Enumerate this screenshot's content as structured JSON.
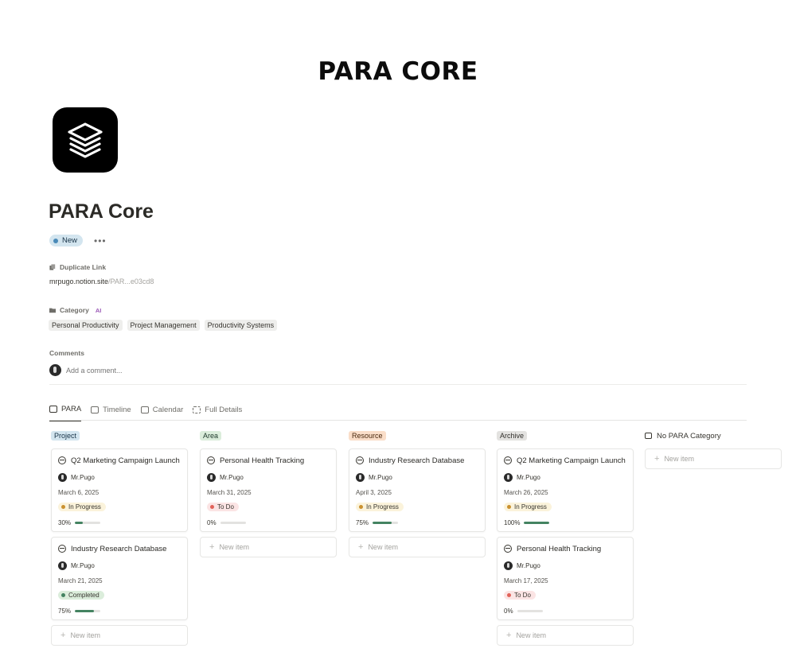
{
  "banner": "PARA CORE",
  "page": {
    "icon": "layers-stack-icon",
    "title": "PARA Core",
    "badge": "New",
    "more": "•••"
  },
  "properties": {
    "duplicate_link": {
      "label": "Duplicate Link",
      "value_main": "mrpugo.notion.site",
      "value_faint": "/PAR...e03cd8"
    },
    "category": {
      "label": "Category",
      "ai": "AI",
      "tags": [
        "Personal Productivity",
        "Project Management",
        "Productivity Systems"
      ]
    },
    "comments": {
      "label": "Comments",
      "placeholder": "Add a comment..."
    }
  },
  "tabs": [
    {
      "label": "PARA",
      "icon": "board-icon",
      "active": true
    },
    {
      "label": "Timeline",
      "icon": "timeline-icon",
      "active": false
    },
    {
      "label": "Calendar",
      "icon": "calendar-icon",
      "active": false
    },
    {
      "label": "Full Details",
      "icon": "expand-icon",
      "active": false
    }
  ],
  "colors": {
    "in_progress_bg": "#fbf3db",
    "in_progress_dot": "#cb912f",
    "todo_bg": "#fbe4e4",
    "todo_dot": "#e16259",
    "completed_bg": "#dbeddb",
    "completed_dot": "#448361"
  },
  "board": {
    "new_item_label": "New item",
    "columns": [
      {
        "name": "Project",
        "tag_bg": "#d3e5ef",
        "tag_color": "#183347",
        "cards": [
          {
            "title": "Q2 Marketing Campaign Launch",
            "owner": "Mr.Pugo",
            "date": "March 6, 2025",
            "status": "In Progress",
            "progress_label": "30%",
            "progress": 0.3
          },
          {
            "title": "Industry Research Database",
            "owner": "Mr.Pugo",
            "date": "March 21, 2025",
            "status": "Completed",
            "progress_label": "75%",
            "progress": 0.75
          }
        ]
      },
      {
        "name": "Area",
        "tag_bg": "#dbeddb",
        "tag_color": "#1c3829",
        "cards": [
          {
            "title": "Personal Health Tracking",
            "owner": "Mr.Pugo",
            "date": "March 31, 2025",
            "status": "To Do",
            "progress_label": "0%",
            "progress": 0
          }
        ]
      },
      {
        "name": "Resource",
        "tag_bg": "#fadec9",
        "tag_color": "#49290e",
        "cards": [
          {
            "title": "Industry Research Database",
            "owner": "Mr.Pugo",
            "date": "April 3, 2025",
            "status": "In Progress",
            "progress_label": "75%",
            "progress": 0.75
          }
        ]
      },
      {
        "name": "Archive",
        "tag_bg": "#e3e2e0",
        "tag_color": "#32302c",
        "cards": [
          {
            "title": "Q2 Marketing Campaign Launch",
            "owner": "Mr.Pugo",
            "date": "March 26, 2025",
            "status": "In Progress",
            "progress_label": "100%",
            "progress": 1.0
          },
          {
            "title": "Personal Health Tracking",
            "owner": "Mr.Pugo",
            "date": "March 17, 2025",
            "status": "To Do",
            "progress_label": "0%",
            "progress": 0
          }
        ]
      }
    ],
    "no_category": {
      "label": "No PARA Category",
      "icon": "inbox-icon"
    }
  }
}
